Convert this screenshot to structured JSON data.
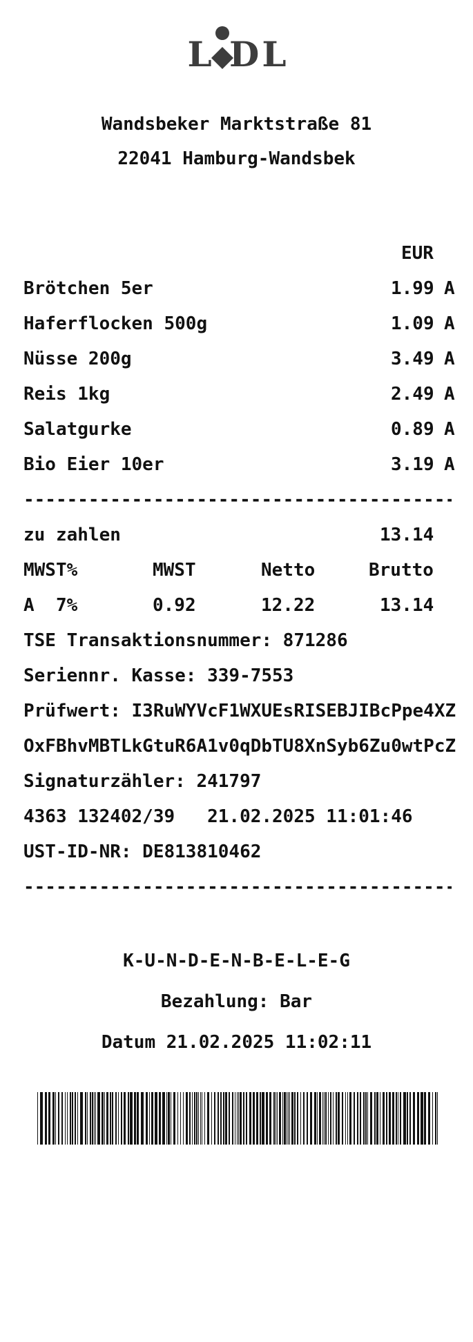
{
  "header": {
    "logo_text": "LIDL",
    "address_line1": "Wandsbeker Marktstraße 81",
    "address_line2": "22041 Hamburg-Wandsbek"
  },
  "items": {
    "currency": "EUR",
    "rows": [
      {
        "name": "Brötchen 5er",
        "price": "1.99",
        "tax": "A"
      },
      {
        "name": "Haferflocken 500g",
        "price": "1.09",
        "tax": "A"
      },
      {
        "name": "Nüsse 200g",
        "price": "3.49",
        "tax": "A"
      },
      {
        "name": "Reis 1kg",
        "price": "2.49",
        "tax": "A"
      },
      {
        "name": "Salatgurke",
        "price": "0.89",
        "tax": "A"
      },
      {
        "name": "Bio Eier 10er",
        "price": "3.19",
        "tax": "A"
      }
    ]
  },
  "separator": "----------------------------------------",
  "total": {
    "label": "zu zahlen",
    "value": "13.14"
  },
  "tax_table": {
    "headers": [
      "MWST%",
      "MWST",
      "Netto",
      "Brutto"
    ],
    "row": {
      "code": "A",
      "rate": "7%",
      "mwst": "0.92",
      "netto": "12.22",
      "brutto": "13.14"
    }
  },
  "tse": {
    "transaction": "TSE Transaktionsnummer: 871286",
    "serial": "Seriennr. Kasse: 339-7553",
    "pruefwert1": "Prüfwert: I3RuWYVcF1WXUEsRISEBJIBcPpe4XZ",
    "pruefwert2": "OxFBhvMBTLkGtuR6A1v0qDbTU8XnSyb6Zu0wtPcZ",
    "signature_counter": "Signaturzähler: 241797",
    "terminal_line": "4363 132402/39   21.02.2025 11:01:46",
    "ust_id": "UST-ID-NR: DE813810462"
  },
  "footer": {
    "title": "K-U-N-D-E-N-B-E-L-E-G",
    "payment": "Bezahlung: Bar",
    "date": "Datum 21.02.2025 11:02:11"
  },
  "colors": {
    "ink": "#111111",
    "logo": "#3d3d3d",
    "paper": "#ffffff"
  }
}
